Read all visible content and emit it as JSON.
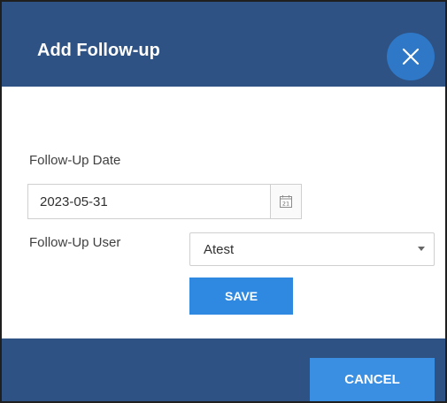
{
  "dialog": {
    "title": "Add Follow-up",
    "close_icon": "close-icon"
  },
  "form": {
    "date_label": "Follow-Up Date",
    "date_value": "2023-05-31",
    "calendar_icon": "calendar-icon",
    "calendar_icon_text": "21",
    "user_label": "Follow-Up User",
    "user_selected": "Atest",
    "save_label": "SAVE"
  },
  "footer": {
    "cancel_label": "CANCEL"
  },
  "colors": {
    "header_bg": "#2e5283",
    "close_button": "#2f78c8",
    "primary_button": "#2f89e0"
  }
}
